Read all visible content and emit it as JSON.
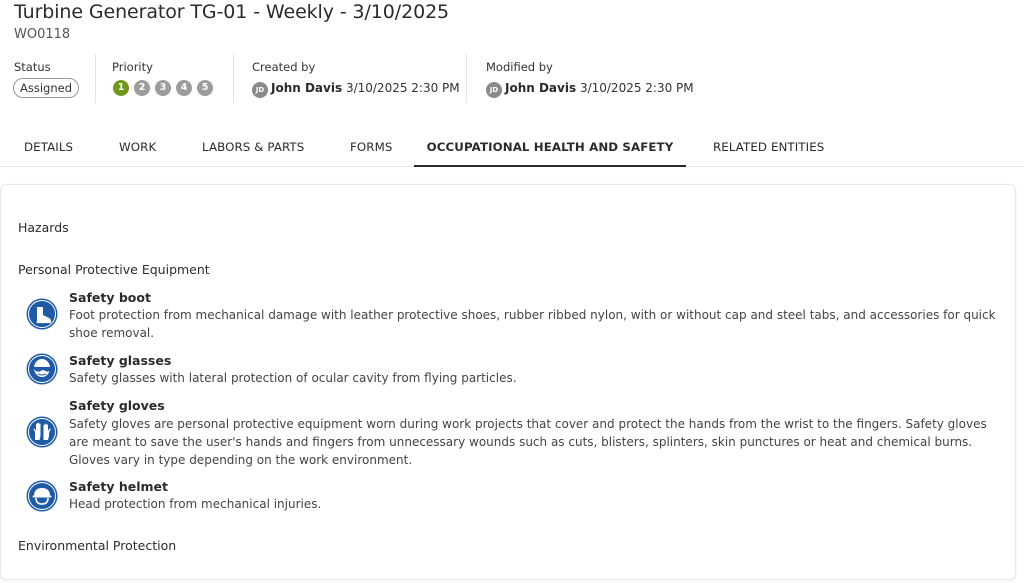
{
  "header": {
    "title": "Turbine Generator TG-01 - Weekly - 3/10/2025",
    "work_order_id": "WO0118"
  },
  "meta": {
    "status_label": "Status",
    "status_value": "Assigned",
    "priority_label": "Priority",
    "priorities": [
      {
        "value": "1",
        "color": "#6e9a1c",
        "selected": true
      },
      {
        "value": "2",
        "color": "#9c9c9c",
        "selected": false
      },
      {
        "value": "3",
        "color": "#9c9c9c",
        "selected": false
      },
      {
        "value": "4",
        "color": "#9c9c9c",
        "selected": false
      },
      {
        "value": "5",
        "color": "#9c9c9c",
        "selected": false
      }
    ],
    "created_label": "Created by",
    "created_initials": "JD",
    "created_name": "John Davis",
    "created_date": "3/10/2025 2:30 PM",
    "modified_label": "Modified by",
    "modified_initials": "JD",
    "modified_name": "John Davis",
    "modified_date": "3/10/2025 2:30 PM"
  },
  "tabs": [
    {
      "label": "DETAILS",
      "active": false
    },
    {
      "label": "WORK",
      "active": false
    },
    {
      "label": "LABORS & PARTS",
      "active": false
    },
    {
      "label": "FORMS",
      "active": false
    },
    {
      "label": "OCCUPATIONAL HEALTH AND SAFETY",
      "active": true
    },
    {
      "label": "RELATED ENTITIES",
      "active": false
    }
  ],
  "content": {
    "hazards_heading": "Hazards",
    "ppe_heading": "Personal Protective Equipment",
    "ppe_items": [
      {
        "name": "Safety boot",
        "icon": "boot-icon",
        "description": "Foot protection from mechanical damage with leather protective shoes, rubber ribbed nylon, with or without cap and steel tabs, and accessories for quick shoe removal."
      },
      {
        "name": "Safety glasses",
        "icon": "glasses-icon",
        "description": "Safety glasses with lateral protection of ocular cavity from flying particles."
      },
      {
        "name": "Safety gloves",
        "icon": "gloves-icon",
        "description": "Safety gloves are personal protective equipment worn during work projects that cover and protect the hands from the wrist to the fingers. Safety gloves are meant to save the user's hands and fingers from unnecessary wounds such as cuts, blisters, splinters, skin punctures or heat and chemical burns. Gloves vary in type depending on the work environment."
      },
      {
        "name": "Safety helmet",
        "icon": "helmet-icon",
        "description": "Head protection from mechanical injuries."
      }
    ],
    "environmental_heading": "Environmental Protection"
  },
  "colors": {
    "ppe_icon_blue": "#1e5aa6",
    "priority_selected": "#6e9a1c",
    "priority_default": "#9c9c9c"
  }
}
